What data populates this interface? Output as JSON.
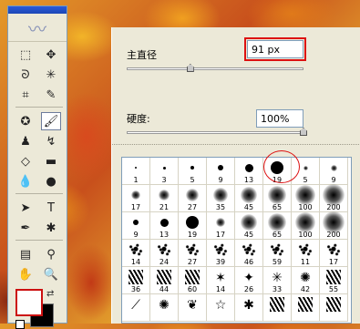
{
  "toolbox": {
    "tools": [
      {
        "name": "rectangular-marquee-tool",
        "glyph": "⬚"
      },
      {
        "name": "move-tool",
        "glyph": "✥"
      },
      {
        "name": "lasso-tool",
        "glyph": "ᘐ"
      },
      {
        "name": "magic-wand-tool",
        "glyph": "✳"
      },
      {
        "name": "crop-tool",
        "glyph": "⌗"
      },
      {
        "name": "slice-tool",
        "glyph": "✎"
      },
      {
        "sep": true
      },
      {
        "name": "healing-brush-tool",
        "glyph": "✪"
      },
      {
        "name": "brush-tool",
        "glyph": "🖌",
        "active": true
      },
      {
        "name": "clone-stamp-tool",
        "glyph": "♟"
      },
      {
        "name": "history-brush-tool",
        "glyph": "↯"
      },
      {
        "name": "eraser-tool",
        "glyph": "◇"
      },
      {
        "name": "gradient-tool",
        "glyph": "▬"
      },
      {
        "name": "blur-tool",
        "glyph": "💧"
      },
      {
        "name": "dodge-tool",
        "glyph": "●"
      },
      {
        "sep": true
      },
      {
        "name": "path-selection-tool",
        "glyph": "➤"
      },
      {
        "name": "type-tool",
        "glyph": "T"
      },
      {
        "name": "pen-tool",
        "glyph": "✒"
      },
      {
        "name": "custom-shape-tool",
        "glyph": "✱"
      },
      {
        "sep": true
      },
      {
        "name": "notes-tool",
        "glyph": "▤"
      },
      {
        "name": "eyedropper-tool",
        "glyph": "⚲"
      },
      {
        "name": "hand-tool",
        "glyph": "✋"
      },
      {
        "name": "zoom-tool",
        "glyph": "🔍"
      }
    ],
    "colors": {
      "foreground": "#ffffff",
      "background": "#000000"
    }
  },
  "panel": {
    "diameter_label": "主直径",
    "diameter_value": "91 px",
    "diameter_level": 0.36,
    "hardness_label": "硬度:",
    "hardness_value": "100%",
    "hardness_level": 1.0
  },
  "brushes": [
    {
      "n": "1",
      "t": "hard",
      "s": 2
    },
    {
      "n": "3",
      "t": "hard",
      "s": 3
    },
    {
      "n": "5",
      "t": "hard",
      "s": 4
    },
    {
      "n": "9",
      "t": "hard",
      "s": 6
    },
    {
      "n": "13",
      "t": "hard",
      "s": 9
    },
    {
      "n": "19",
      "t": "hard",
      "s": 14
    },
    {
      "n": "5",
      "t": "soft",
      "s": 5
    },
    {
      "n": "9",
      "t": "soft",
      "s": 7
    },
    {
      "n": "17",
      "t": "soft",
      "s": 10
    },
    {
      "n": "21",
      "t": "soft",
      "s": 12
    },
    {
      "n": "27",
      "t": "soft",
      "s": 14
    },
    {
      "n": "35",
      "t": "soft",
      "s": 16
    },
    {
      "n": "45",
      "t": "soft",
      "s": 18
    },
    {
      "n": "65",
      "t": "soft",
      "s": 20
    },
    {
      "n": "100",
      "t": "soft",
      "s": 22
    },
    {
      "n": "200",
      "t": "soft",
      "s": 24
    },
    {
      "n": "9",
      "t": "hard",
      "s": 6
    },
    {
      "n": "13",
      "t": "hard",
      "s": 9
    },
    {
      "n": "19",
      "t": "hard",
      "s": 14
    },
    {
      "n": "17",
      "t": "soft",
      "s": 10
    },
    {
      "n": "45",
      "t": "soft",
      "s": 18
    },
    {
      "n": "65",
      "t": "soft",
      "s": 20
    },
    {
      "n": "100",
      "t": "soft",
      "s": 22
    },
    {
      "n": "200",
      "t": "soft",
      "s": 24
    },
    {
      "n": "14",
      "t": "scatter"
    },
    {
      "n": "24",
      "t": "scatter"
    },
    {
      "n": "27",
      "t": "scatter"
    },
    {
      "n": "39",
      "t": "scatter"
    },
    {
      "n": "46",
      "t": "scatter"
    },
    {
      "n": "59",
      "t": "scatter"
    },
    {
      "n": "11",
      "t": "scatter"
    },
    {
      "n": "17",
      "t": "scatter"
    },
    {
      "n": "36",
      "t": "stroke"
    },
    {
      "n": "44",
      "t": "stroke"
    },
    {
      "n": "60",
      "t": "stroke"
    },
    {
      "n": "14",
      "t": "glyph",
      "g": "✶"
    },
    {
      "n": "26",
      "t": "glyph",
      "g": "✦"
    },
    {
      "n": "33",
      "t": "glyph",
      "g": "✳"
    },
    {
      "n": "42",
      "t": "glyph",
      "g": "✺"
    },
    {
      "n": "55",
      "t": "stroke"
    },
    {
      "n": "",
      "t": "glyph",
      "g": "⟋"
    },
    {
      "n": "",
      "t": "glyph",
      "g": "✺"
    },
    {
      "n": "",
      "t": "glyph",
      "g": "❦"
    },
    {
      "n": "",
      "t": "glyph",
      "g": "☆"
    },
    {
      "n": "",
      "t": "glyph",
      "g": "✱"
    },
    {
      "n": "",
      "t": "stroke"
    },
    {
      "n": "",
      "t": "stroke"
    },
    {
      "n": "",
      "t": "stroke"
    }
  ]
}
